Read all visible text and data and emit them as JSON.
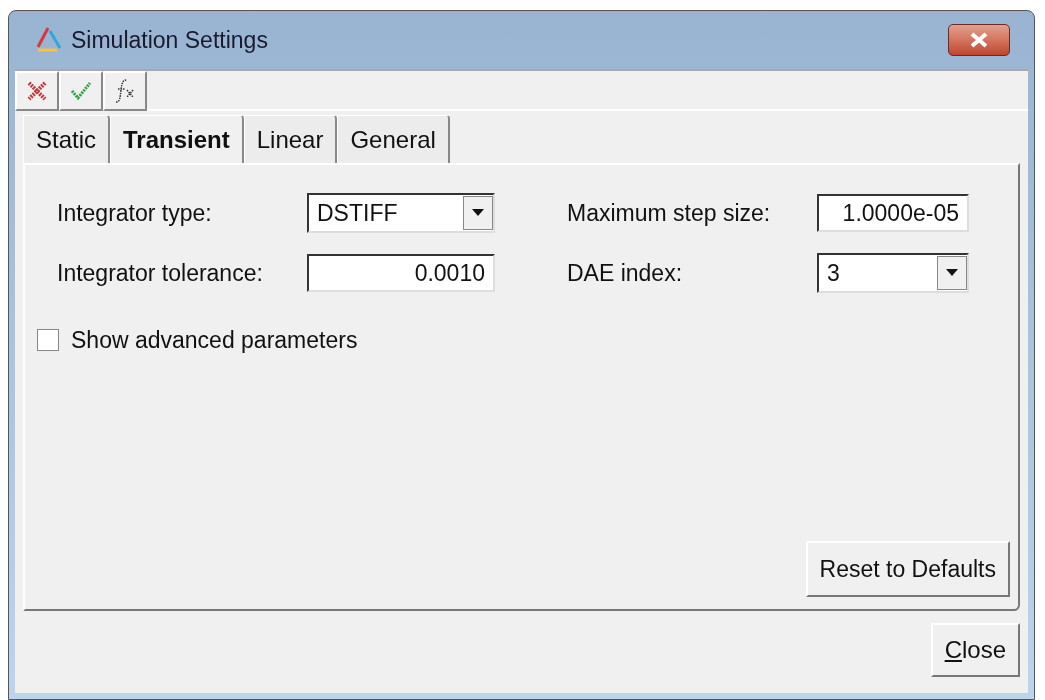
{
  "window": {
    "title": "Simulation Settings"
  },
  "toolbar": [
    {
      "kind": "cancel"
    },
    {
      "kind": "apply"
    },
    {
      "kind": "function"
    }
  ],
  "tabs": [
    {
      "label": "Static",
      "selected": false
    },
    {
      "label": "Transient",
      "selected": true
    },
    {
      "label": "Linear",
      "selected": false
    },
    {
      "label": "General",
      "selected": false
    }
  ],
  "fields": [
    {
      "label": "Integrator type:",
      "kind": "dropdown",
      "value": "DSTIFF"
    },
    {
      "label": "Maximum step size:",
      "kind": "text",
      "value": "1.0000e-05"
    },
    {
      "label": "Integrator tolerance:",
      "kind": "text",
      "value": "0.0010"
    },
    {
      "label": "DAE index:",
      "kind": "dropdown",
      "value": "3"
    }
  ],
  "advanced": {
    "label": "Show advanced parameters",
    "checked": false
  },
  "reset_button": "Reset to Defaults",
  "close_button": {
    "label": "Close",
    "underline_first": true
  }
}
